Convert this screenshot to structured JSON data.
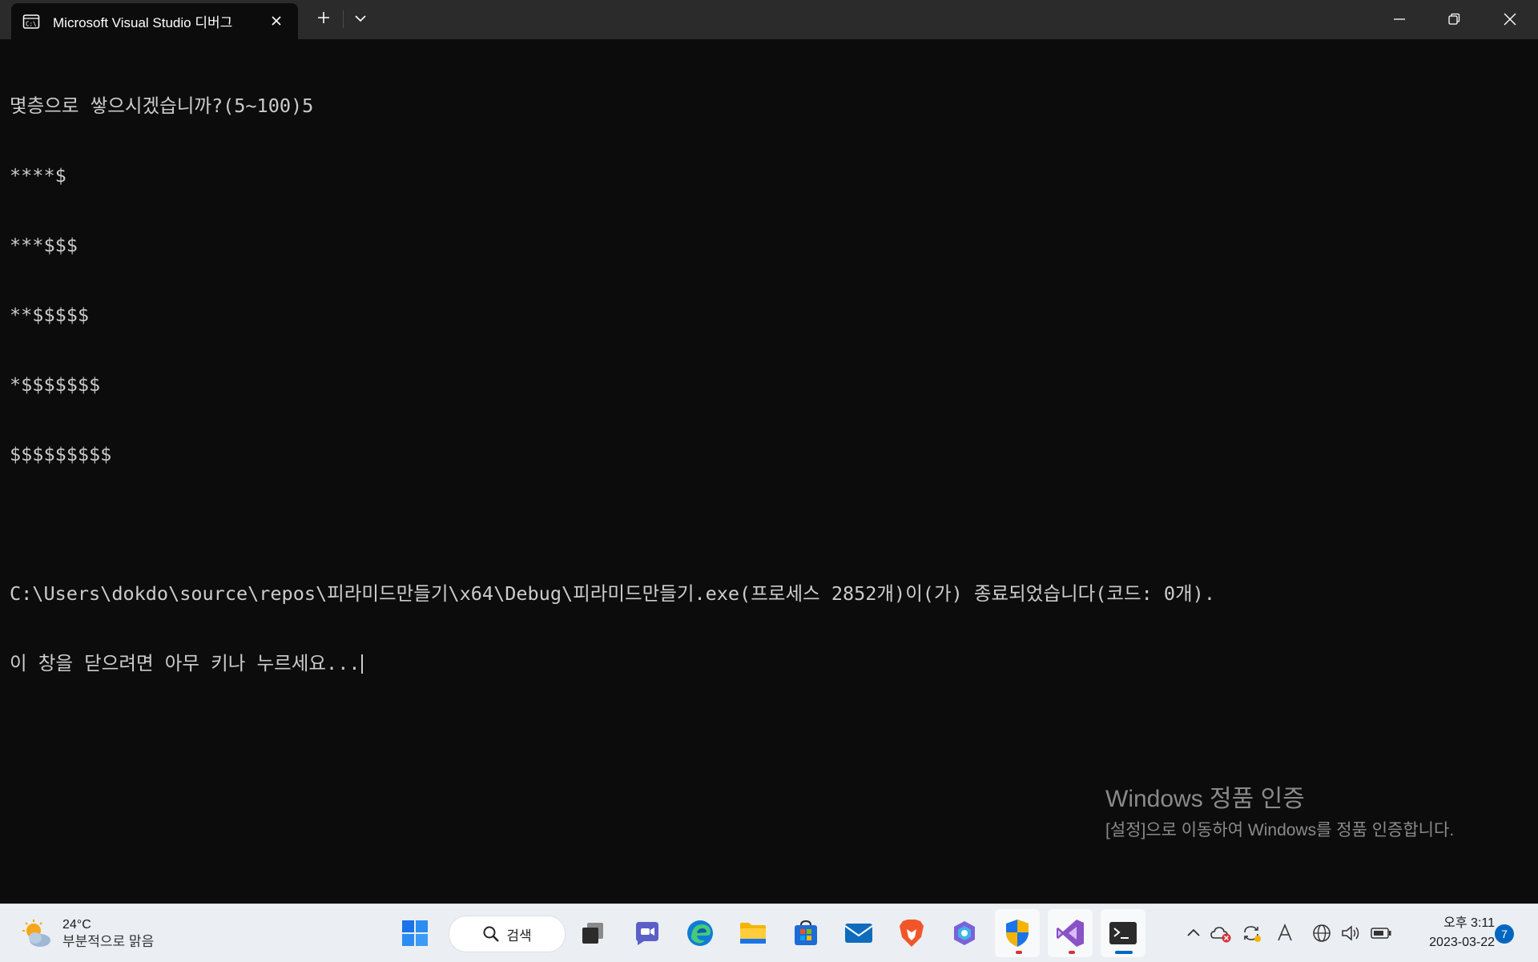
{
  "window": {
    "tab_title": "Microsoft Visual Studio 디버그",
    "tab_icon": "console-icon"
  },
  "console": {
    "lines": [
      "몇층으로 쌓으시겠습니까?(5~100)5",
      "****$",
      "***$$$",
      "**$$$$$",
      "*$$$$$$$",
      "$$$$$$$$$",
      "",
      "C:\\Users\\dokdo\\source\\repos\\피라미드만들기\\x64\\Debug\\피라미드만들기.exe(프로세스 2852개)이(가) 종료되었습니다(코드: 0개).",
      "이 창을 닫으려면 아무 키나 누르세요..."
    ],
    "text_color": "#cccccc",
    "background": "#0c0c0c"
  },
  "watermark": {
    "title": "Windows 정품 인증",
    "body": "[설정]으로 이동하여 Windows를 정품 인증합니다."
  },
  "taskbar": {
    "weather": {
      "temp": "24°C",
      "desc": "부분적으로 맑음"
    },
    "search_label": "검색",
    "apps": [
      "windows-start-icon",
      "task-view-icon",
      "chat-icon",
      "edge-icon",
      "file-explorer-icon",
      "store-icon",
      "mail-icon",
      "brave-icon",
      "copilot-icon",
      "security-icon",
      "visual-studio-icon",
      "terminal-icon"
    ],
    "clock": {
      "time": "오후 3:11",
      "date": "2023-03-22"
    },
    "notification_count": "7",
    "accent": "#0067c0"
  }
}
